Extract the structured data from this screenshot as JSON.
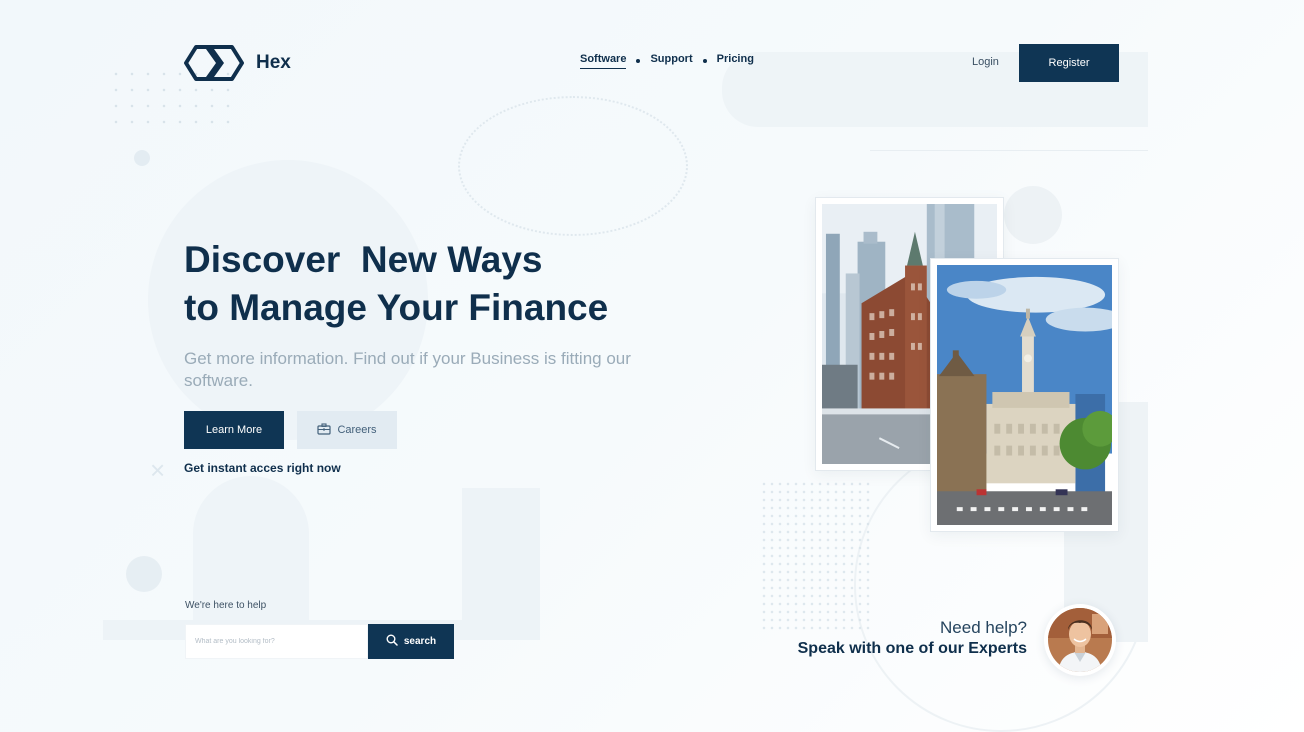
{
  "header": {
    "brand": "Hex",
    "nav": [
      {
        "label": "Software",
        "active": true
      },
      {
        "label": "Support",
        "active": false
      },
      {
        "label": "Pricing",
        "active": false
      }
    ],
    "login_label": "Login",
    "register_label": "Register"
  },
  "hero": {
    "headline": "Discover  New Ways\nto Manage Your Finance",
    "subtitle": "Get more information. Find out if your Business is fitting our software.",
    "learn_more_label": "Learn More",
    "careers_label": "Careers",
    "instant_access": "Get instant acces right now"
  },
  "search": {
    "label": "We're here to help",
    "placeholder": "What are you looking for?",
    "button_label": "search"
  },
  "expert": {
    "need_help": "Need help?",
    "speak": "Speak with one of our Experts"
  },
  "colors": {
    "primary": "#0f3554",
    "text_dark": "#0f2f4c",
    "muted": "#9aabb8",
    "secondary_button": "#e2ebf2"
  },
  "icons": [
    "hex-logo-icon",
    "briefcase-icon",
    "search-icon"
  ]
}
